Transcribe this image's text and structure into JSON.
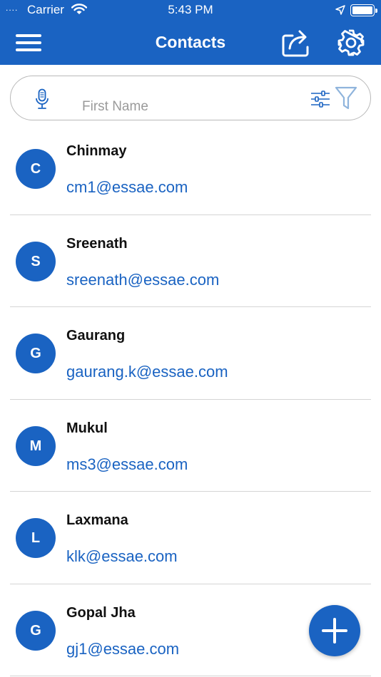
{
  "status_bar": {
    "signal": "....",
    "carrier": "Carrier",
    "time": "5:43 PM"
  },
  "header": {
    "title": "Contacts",
    "menu_icon": "hamburger-menu-icon",
    "share_icon": "share-icon",
    "settings_icon": "gear-icon"
  },
  "search": {
    "placeholder": "First Name",
    "value": "",
    "mic_icon": "microphone-icon",
    "sliders_icon": "sliders-icon",
    "filter_icon": "funnel-icon"
  },
  "contacts": [
    {
      "initial": "C",
      "name": "Chinmay",
      "email": "cm1@essae.com"
    },
    {
      "initial": "S",
      "name": "Sreenath",
      "email": "sreenath@essae.com"
    },
    {
      "initial": "G",
      "name": "Gaurang",
      "email": "gaurang.k@essae.com"
    },
    {
      "initial": "M",
      "name": "Mukul",
      "email": "ms3@essae.com"
    },
    {
      "initial": "L",
      "name": "Laxmana",
      "email": "klk@essae.com"
    },
    {
      "initial": "G",
      "name": "Gopal Jha",
      "email": "gj1@essae.com"
    }
  ],
  "fab": {
    "icon": "plus-icon"
  },
  "colors": {
    "primary": "#1a63c2",
    "divider": "#d4d4d4",
    "placeholder": "#9a9a9a",
    "filter_light": "#8fb4dc"
  }
}
